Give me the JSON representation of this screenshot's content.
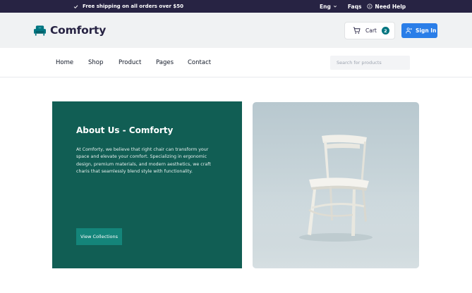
{
  "topbar": {
    "shipping_text": "Free shipping on all orders over $50",
    "language": "Eng",
    "faqs": "Faqs",
    "need_help": "Need Help"
  },
  "header": {
    "brand": "Comforty",
    "cart_label": "Cart",
    "cart_count": "2",
    "signin_label": "Sign In"
  },
  "nav": {
    "items": [
      "Home",
      "Shop",
      "Product",
      "Pages",
      "Contact"
    ],
    "search_placeholder": "Search for products"
  },
  "about": {
    "title": "About Us - Comforty",
    "body": "At Comforty, we believe that right chair can transform your space and elevate your comfort. Specializing in ergonomic design, premium materials, and modern aesthetics, we craft charis that seamlessly blend style with functionality.",
    "button": "View Collections"
  },
  "colors": {
    "topbar_bg": "#272343",
    "header_bg": "#f0f2f3",
    "brand_teal": "#007580",
    "card_green": "#115e54",
    "signin_blue": "#2a7ee8"
  },
  "icons": {
    "shipping": "check-icon",
    "help": "info-circle-icon",
    "logo": "armchair-icon",
    "cart": "cart-icon",
    "signin": "user-icon"
  }
}
